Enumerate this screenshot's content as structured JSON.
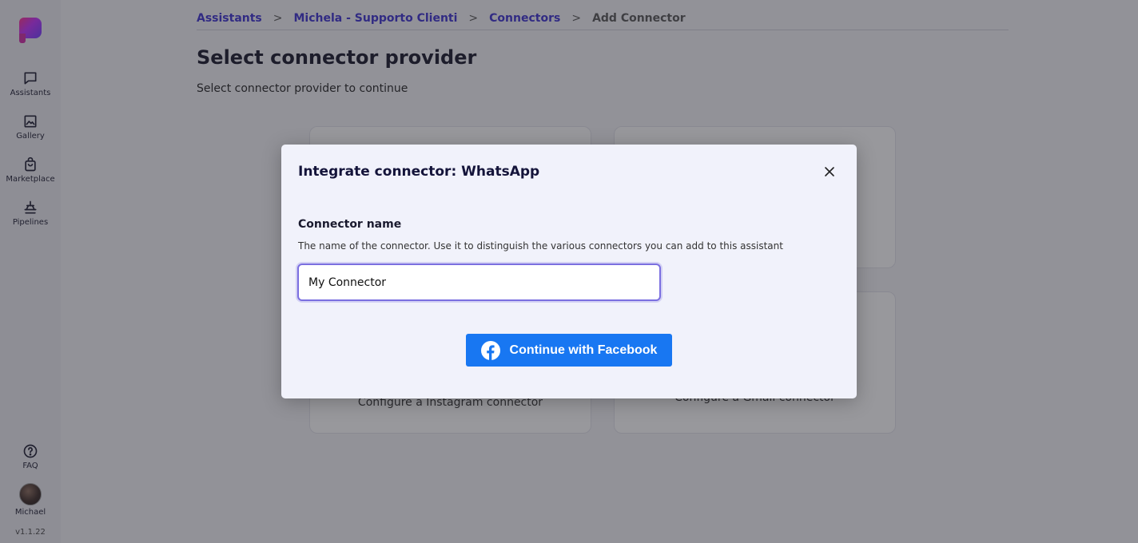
{
  "sidebar": {
    "items": [
      {
        "label": "Assistants",
        "icon": "chat-icon"
      },
      {
        "label": "Gallery",
        "icon": "image-icon"
      },
      {
        "label": "Marketplace",
        "icon": "bag-icon"
      },
      {
        "label": "Pipelines",
        "icon": "pipeline-icon"
      }
    ],
    "faq_label": "FAQ",
    "user_name": "Michael",
    "version": "v1.1.22"
  },
  "breadcrumb": {
    "items": [
      "Assistants",
      "Michela - Supporto Clienti",
      "Connectors"
    ],
    "current": "Add Connector",
    "separator": ">"
  },
  "page": {
    "title": "Select connector provider",
    "subtitle": "Select connector provider to continue"
  },
  "cards": [
    {
      "desc": ""
    },
    {
      "desc": ""
    },
    {
      "desc": "Configure a Instagram connector"
    },
    {
      "desc": "Configure a Gmail connector"
    }
  ],
  "modal": {
    "title": "Integrate connector: WhatsApp",
    "field_label": "Connector name",
    "field_help": "The name of the connector. Use it to distinguish the various connectors you can add to this assistant",
    "field_value": "My Connector",
    "button_label": "Continue with Facebook"
  },
  "colors": {
    "accent": "#3a2fd0",
    "facebook": "#1877f2",
    "input_focus": "#7b6fe0"
  }
}
